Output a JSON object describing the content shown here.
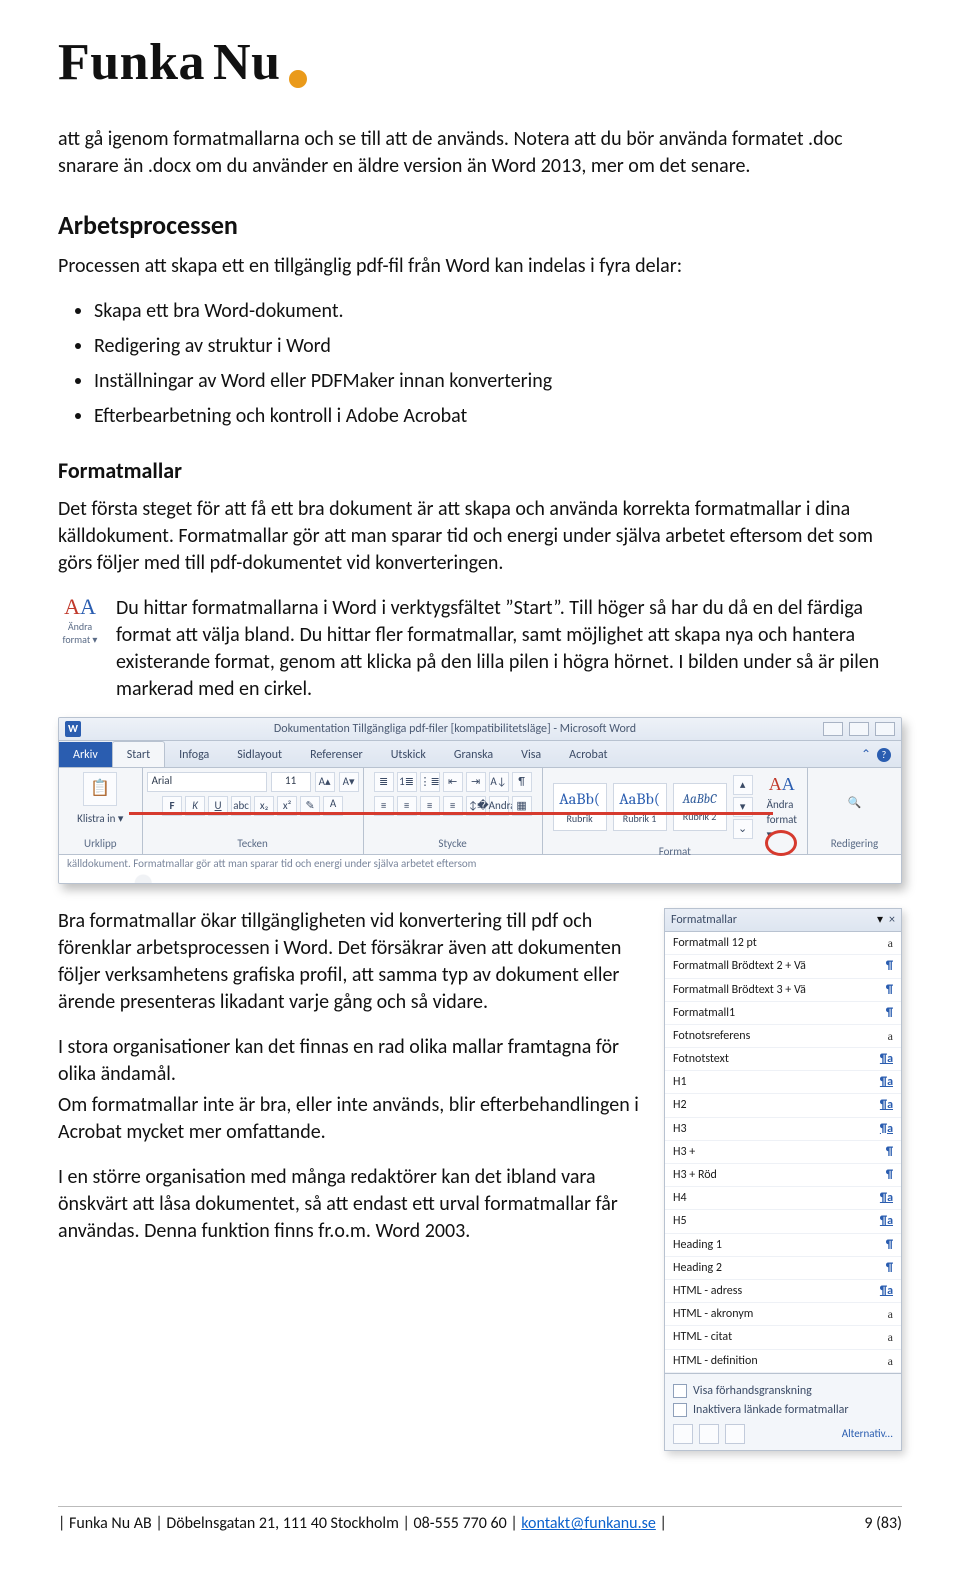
{
  "logo": {
    "w1": "Funka",
    "w2": "Nu"
  },
  "intro": "att gå igenom formatmallarna och se till att de används. Notera att du bör använda formatet .doc snarare än .docx om du använder en äldre version än Word 2013, mer om det senare.",
  "process": {
    "heading": "Arbetsprocessen",
    "lead": "Processen att skapa ett en tillgänglig pdf-fil från Word kan indelas i fyra delar:",
    "items": [
      "Skapa ett bra Word-dokument.",
      "Redigering av struktur i Word",
      "Inställningar av Word eller PDFMaker innan konvertering",
      "Efterbearbetning och kontroll i Adobe Acrobat"
    ]
  },
  "format": {
    "heading": "Formatmallar",
    "p1": "Det första steget för att få ett bra dokument är att skapa och använda korrekta formatmallar i dina källdokument. Formatmallar gör att man sparar tid och energi under själva arbetet eftersom det som görs följer med till pdf-dokumentet vid konverteringen.",
    "icon": {
      "label1": "Ändra",
      "label2": "format ▾"
    },
    "p2": "Du hittar formatmallarna i Word i verktygsfältet ”Start”. Till höger så har du då en del färdiga format att välja bland. Du hittar fler formatmallar, samt möjlighet att skapa nya och hantera existerande format, genom att klicka på den lilla pilen i högra hörnet. I bilden under så är pilen markerad med en cirkel."
  },
  "ribbon": {
    "title": "Dokumentation Tillgängliga pdf-filer [kompatibilitetsläge] - Microsoft Word",
    "tabs": [
      "Arkiv",
      "Start",
      "Infoga",
      "Sidlayout",
      "Referenser",
      "Utskick",
      "Granska",
      "Visa",
      "Acrobat"
    ],
    "groups": {
      "clipboard": {
        "label": "Urklipp",
        "paste": "Klistra in ▾"
      },
      "font": {
        "label": "Tecken",
        "family": "Arial",
        "size": "11"
      },
      "para": {
        "label": "Stycke"
      },
      "styles": {
        "label": "Format",
        "thumbs": [
          {
            "sample": "AaBb(",
            "name": "Rubrik"
          },
          {
            "sample": "AaBb(",
            "name": "Rubrik 1"
          },
          {
            "sample": "AaBbC",
            "name": "Rubrik 2"
          }
        ],
        "change": "Ändra format ▾"
      },
      "editing": {
        "label": "Redigering"
      }
    },
    "torn": "källdokument. Formatmallar gör att man sparar tid och energi under själva arbetet eftersom"
  },
  "after": {
    "p1": "Bra formatmallar ökar tillgängligheten vid konvertering till pdf och förenklar arbetsprocessen i Word. Det försäkrar även att dokumenten följer verksamhetens grafiska profil, att samma typ av dokument eller ärende presenteras likadant varje gång och så vidare.",
    "p2": "I stora organisationer kan det finnas en rad olika mallar framtagna för olika ändamål.",
    "p3": "Om formatmallar inte är bra, eller inte används, blir efterbehandlingen i Acrobat mycket mer omfattande.",
    "p4": "I en större organisation med många redaktörer kan det ibland vara önskvärt att låsa dokumentet, så att endast ett urval formatmallar får användas. Denna funktion finns fr.o.m. Word 2003."
  },
  "pane": {
    "title": "Formatmallar",
    "rows": [
      {
        "n": "Formatmall 12 pt",
        "m": "a"
      },
      {
        "n": "Formatmall Brödtext 2 + Vä",
        "m": "¶"
      },
      {
        "n": "Formatmall Brödtext 3 + Vä",
        "m": "¶"
      },
      {
        "n": "Formatmall1",
        "m": "¶"
      },
      {
        "n": "Fotnotsreferens",
        "m": "a"
      },
      {
        "n": "Fotnotstext",
        "m": "¶a"
      },
      {
        "n": "H1",
        "m": "¶a"
      },
      {
        "n": "H2",
        "m": "¶a"
      },
      {
        "n": "H3",
        "m": "¶a"
      },
      {
        "n": "H3 +",
        "m": "¶"
      },
      {
        "n": "H3 + Röd",
        "m": "¶"
      },
      {
        "n": "H4",
        "m": "¶a"
      },
      {
        "n": "H5",
        "m": "¶a"
      },
      {
        "n": "Heading 1",
        "m": "¶"
      },
      {
        "n": "Heading 2",
        "m": "¶"
      },
      {
        "n": "HTML - adress",
        "m": "¶a"
      },
      {
        "n": "HTML - akronym",
        "m": "a"
      },
      {
        "n": "HTML - citat",
        "m": "a"
      },
      {
        "n": "HTML - definition",
        "m": "a"
      }
    ],
    "chk1": "Visa förhandsgranskning",
    "chk2": "Inaktivera länkade formatmallar",
    "alt": "Alternativ..."
  },
  "footer": {
    "left": "| Funka Nu AB | Döbelnsgatan 21, 111 40 Stockholm | 08-555 770 60 | kontakt@funkanu.se |",
    "right": "9 (83)",
    "email": "kontakt@funkanu.se"
  }
}
